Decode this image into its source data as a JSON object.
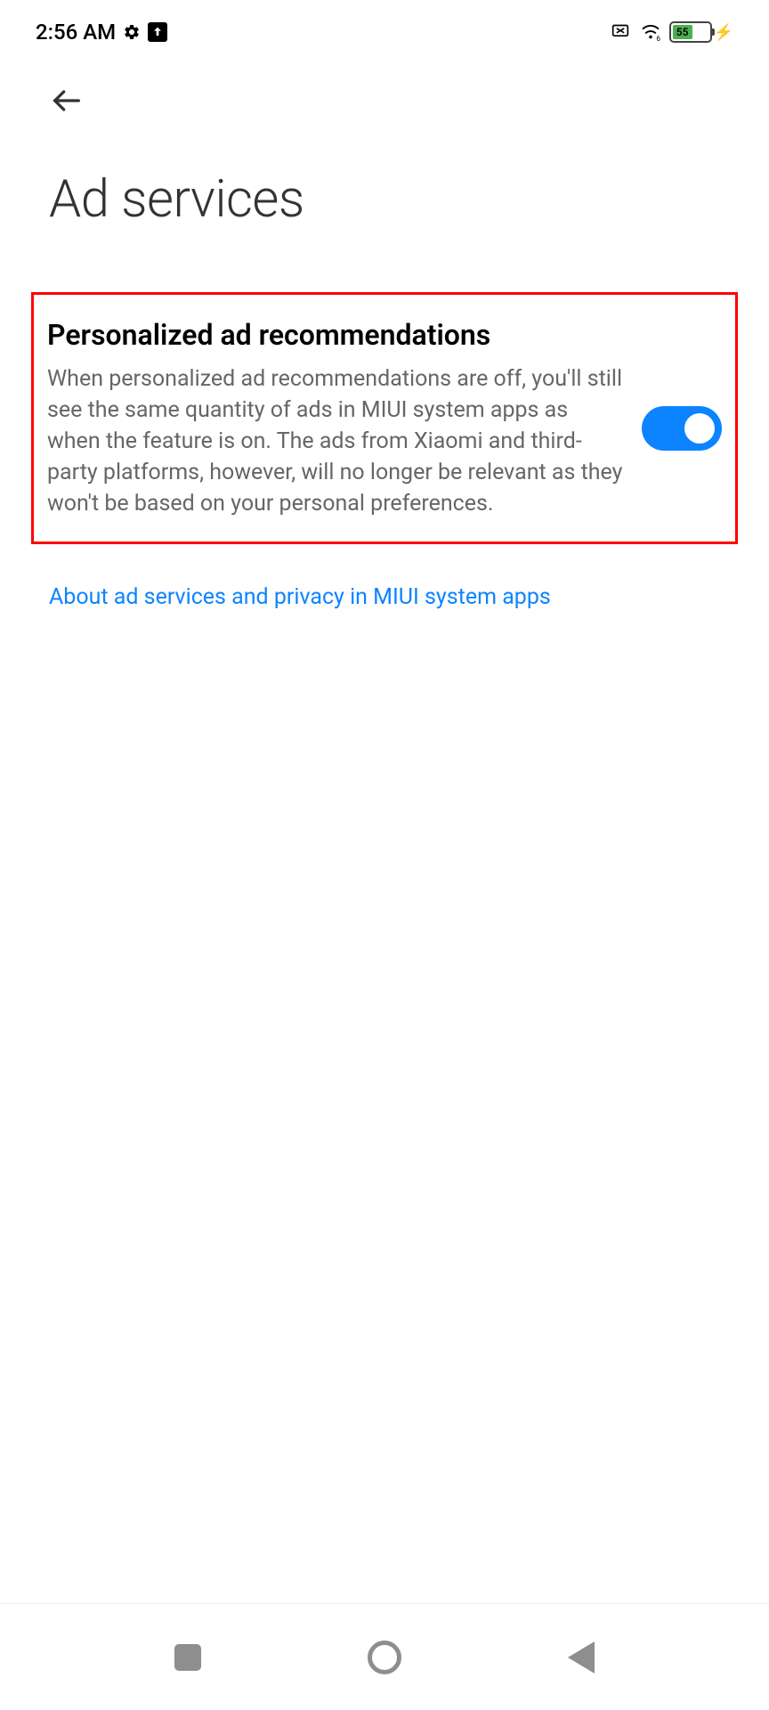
{
  "statusBar": {
    "time": "2:56 AM",
    "batteryLevel": "55"
  },
  "header": {
    "title": "Ad services"
  },
  "settings": {
    "personalizedAds": {
      "title": "Personalized ad recommendations",
      "description": "When personalized ad recommendations are off, you'll still see the same quantity of ads in MIUI system apps as when the feature is on. The ads from Xiaomi and third-party platforms, however, will no longer be relevant as they won't be based on your personal preferences.",
      "enabled": true
    }
  },
  "links": {
    "aboutPrivacy": "About ad services and privacy in MIUI system apps"
  }
}
